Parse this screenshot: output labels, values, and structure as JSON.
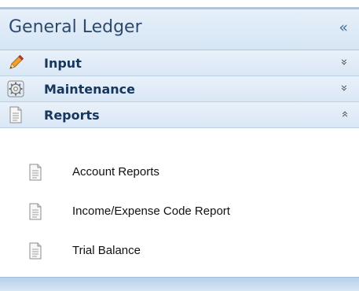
{
  "panel": {
    "title": "General Ledger",
    "collapse_glyph": "«",
    "collapse_icon": "double-chevron-left-icon"
  },
  "groups": [
    {
      "label": "Input",
      "icon": "pencil-icon",
      "chevron": "»",
      "state": "collapsed"
    },
    {
      "label": "Maintenance",
      "icon": "gear-icon",
      "chevron": "»",
      "state": "collapsed"
    },
    {
      "label": "Reports",
      "icon": "document-icon",
      "chevron": "»",
      "state": "expanded"
    }
  ],
  "reports": {
    "items": [
      {
        "label": "Account Reports",
        "icon": "document-icon"
      },
      {
        "label": "Income/Expense Code Report",
        "icon": "document-icon"
      },
      {
        "label": "Trial Balance",
        "icon": "document-icon"
      }
    ]
  },
  "colors": {
    "header_text": "#2e4a6b",
    "group_text": "#17365d",
    "header_bg": "#dce8f6",
    "border": "#aec7e1"
  }
}
